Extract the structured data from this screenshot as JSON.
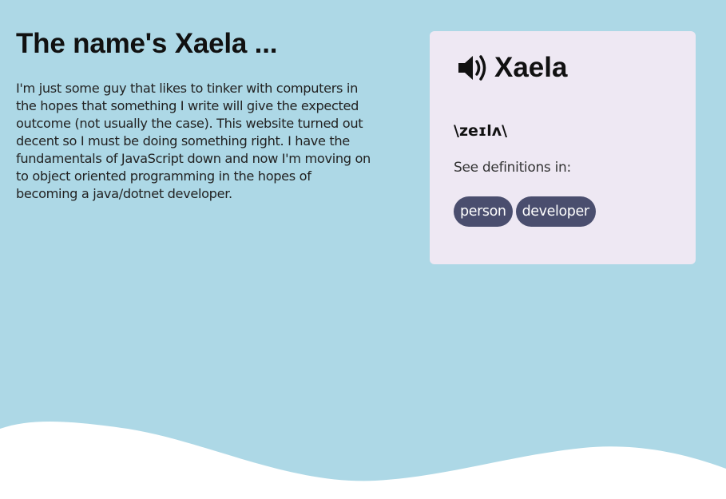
{
  "intro": {
    "heading": "The name's Xaela ...",
    "paragraph": "I'm just some guy that likes to tinker with computers in the hopes that something I write will give the expected outcome (not usually the case). This website turned out decent so I must be doing something right. I have the fundamentals of JavaScript down and now I'm moving on to object oriented programming in the hopes of becoming a java/dotnet developer."
  },
  "card": {
    "icon": "speaker-icon",
    "word": "Xaela",
    "pronunciation": "\\zeɪlʌ\\",
    "see_definitions": "See definitions in:",
    "tags": [
      "person",
      "developer"
    ]
  },
  "colors": {
    "background": "#add8e6",
    "card_background": "#eee8f3",
    "tag_background": "#4a4e6e",
    "wave": "#ffffff"
  }
}
